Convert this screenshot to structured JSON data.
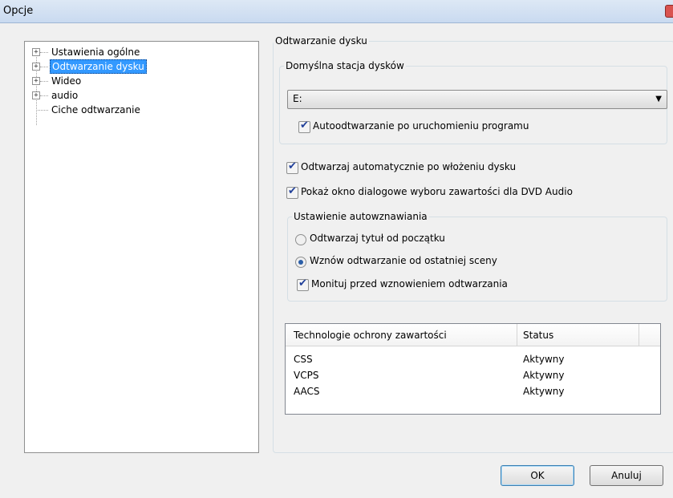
{
  "window": {
    "title": "Opcje"
  },
  "tree": {
    "items": [
      {
        "label": "Ustawienia ogólne",
        "expander": "+"
      },
      {
        "label": "Odtwarzanie dysku",
        "expander": "+"
      },
      {
        "label": "Wideo",
        "expander": "+"
      },
      {
        "label": "audio",
        "expander": "+"
      },
      {
        "label": "Ciche odtwarzanie",
        "expander": ""
      }
    ]
  },
  "panel": {
    "title": "Odtwarzanie dysku",
    "default_drive": {
      "title": "Domyślna stacja dysków",
      "selected": "E:",
      "autoplay_label": "Autoodtwarzanie po uruchomieniu programu",
      "autoplay_checked": true
    },
    "auto_play_insert": {
      "label": "Odtwarzaj automatycznie po włożeniu dysku",
      "checked": true
    },
    "show_dvd_audio_dialog": {
      "label": "Pokaż okno dialogowe wyboru zawartości dla DVD Audio",
      "checked": true
    },
    "resume": {
      "title": "Ustawienie autowznawiania",
      "option_start": "Odtwarzaj tytuł od początku",
      "option_last_scene": "Wznów odtwarzanie od ostatniej sceny",
      "selected": "last_scene",
      "prompt_label": "Monituj przed wznowieniem odtwarzania",
      "prompt_checked": true
    },
    "protection_table": {
      "headers": [
        "Technologie ochrony zawartości",
        "Status"
      ],
      "rows": [
        {
          "tech": "CSS",
          "status": "Aktywny"
        },
        {
          "tech": "VCPS",
          "status": "Aktywny"
        },
        {
          "tech": "AACS",
          "status": "Aktywny"
        }
      ]
    }
  },
  "buttons": {
    "ok": "OK",
    "cancel": "Anuluj"
  },
  "icons": {
    "close": "close-icon",
    "check": "checkmark-icon",
    "dropdown": "chevron-down-icon"
  }
}
